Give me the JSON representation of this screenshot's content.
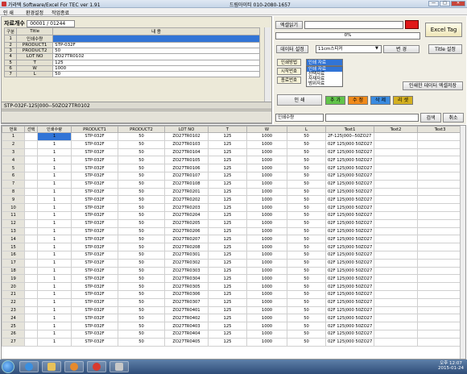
{
  "window": {
    "title": "가라텍 Software/Excel  For TEC    ver 1.91",
    "phone": "드림아이티 010-2080-1657"
  },
  "menu": [
    "인    쇄",
    "환경설정",
    "작업종료"
  ],
  "record": {
    "label": "자료개수",
    "value": "00001 / 01244"
  },
  "field_table": {
    "headers": [
      "구분",
      "Title",
      "내 용"
    ],
    "rows": [
      {
        "no": "1",
        "name": "인쇄수량",
        "value": "",
        "selected": true
      },
      {
        "no": "2",
        "name": "PRODUCT1",
        "value": "STP-032F",
        "selected": false
      },
      {
        "no": "3",
        "name": "PRODUCT2",
        "value": "50",
        "selected": false
      },
      {
        "no": "4",
        "name": "LOT NO",
        "value": "ZO27TR0102",
        "selected": false
      },
      {
        "no": "5",
        "name": "T",
        "value": "125",
        "selected": false
      },
      {
        "no": "6",
        "name": "W",
        "value": "1000",
        "selected": false
      },
      {
        "no": "7",
        "name": "L",
        "value": "50",
        "selected": false
      }
    ]
  },
  "barcode_text": "STP-032F-125|000--50ZO27TR0102",
  "right": {
    "excel_read": "엑셀읽기",
    "progress": "0%",
    "excel_tag": "Excel Tag",
    "data_setting": "데이터 설정",
    "label_select": "11cm스티커",
    "change": "변 경",
    "title_setting": "Title 설정",
    "print_method": "인쇄방법",
    "start_no": "시작번호",
    "end_no": "종료번호",
    "print_combo": "인쇄 자료",
    "dropdown_options": [
      "인쇄 자료",
      "선택자료",
      "자재자료",
      "범위자료"
    ],
    "save_printed": "인쇄한 데이터 엑셀저장",
    "print": "인      쇄",
    "add": "추 가",
    "edit": "수 정",
    "delete": "삭 제",
    "reset": "리 셋",
    "search_field": "인쇄수량",
    "search": "검색",
    "cancel": "취소"
  },
  "colors": {
    "add": "#62c44a",
    "edit": "#f08a1a",
    "delete": "#3a8be0",
    "reset": "#d4b020",
    "selection": "#3174d6"
  },
  "grid": {
    "headers": [
      "번호",
      "선택",
      "인쇄수량",
      "PRODUCT1",
      "PRODUCT2",
      "LOT NO",
      "T",
      "W",
      "L",
      "Text1",
      "Text2",
      "Text3"
    ],
    "rows": [
      [
        "1",
        "",
        "1",
        "STP-032F",
        "50",
        "ZO27TR0102",
        "125",
        "1000",
        "50",
        "2F-125|000--50ZO27",
        "",
        ""
      ],
      [
        "2",
        "",
        "1",
        "STP-032F",
        "50",
        "ZO27TR0103",
        "125",
        "1000",
        "50",
        "02F 125|000 50ZO27",
        "",
        ""
      ],
      [
        "3",
        "",
        "1",
        "STP-032F",
        "50",
        "ZO27TR0104",
        "125",
        "1000",
        "50",
        "02F 125|000 50ZO27",
        "",
        ""
      ],
      [
        "4",
        "",
        "1",
        "STP-032F",
        "50",
        "ZO27TR0105",
        "125",
        "1000",
        "50",
        "02F 125|000 50ZO27",
        "",
        ""
      ],
      [
        "5",
        "",
        "1",
        "STP-032F",
        "50",
        "ZO27TR0106",
        "125",
        "1000",
        "50",
        "02F 125|000 50ZO27",
        "",
        ""
      ],
      [
        "6",
        "",
        "1",
        "STP-032F",
        "50",
        "ZO27TR0107",
        "125",
        "1000",
        "50",
        "02F 125|000 50ZO27",
        "",
        ""
      ],
      [
        "7",
        "",
        "1",
        "STP-032F",
        "50",
        "ZO27TR0108",
        "125",
        "1000",
        "50",
        "02F 125|000 50ZO27",
        "",
        ""
      ],
      [
        "8",
        "",
        "1",
        "STP-032F",
        "50",
        "ZO27TR0201",
        "125",
        "1000",
        "50",
        "02F 125|000 50ZO27",
        "",
        ""
      ],
      [
        "9",
        "",
        "1",
        "STP-032F",
        "50",
        "ZO27TR0202",
        "125",
        "1000",
        "50",
        "02F 125|000 50ZO27",
        "",
        ""
      ],
      [
        "10",
        "",
        "1",
        "STP-032F",
        "50",
        "ZO27TR0203",
        "125",
        "1000",
        "50",
        "02F 125|000 50ZO27",
        "",
        ""
      ],
      [
        "11",
        "",
        "1",
        "STP-032F",
        "50",
        "ZO27TR0204",
        "125",
        "1000",
        "50",
        "02F 125|000 50ZO27",
        "",
        ""
      ],
      [
        "12",
        "",
        "1",
        "STP-032F",
        "50",
        "ZO27TR0205",
        "125",
        "1000",
        "50",
        "02F 125|000 50ZO27",
        "",
        ""
      ],
      [
        "13",
        "",
        "1",
        "STP-032F",
        "50",
        "ZO27TR0206",
        "125",
        "1000",
        "50",
        "02F 125|000 50ZO27",
        "",
        ""
      ],
      [
        "14",
        "",
        "1",
        "STP-032F",
        "50",
        "ZO27TR0207",
        "125",
        "1000",
        "50",
        "02F 125|000 50ZO27",
        "",
        ""
      ],
      [
        "15",
        "",
        "1",
        "STP-032F",
        "50",
        "ZO27TR0208",
        "125",
        "1000",
        "50",
        "02F 125|000 50ZO27",
        "",
        ""
      ],
      [
        "16",
        "",
        "1",
        "STP-032F",
        "50",
        "ZO27TR0301",
        "125",
        "1000",
        "50",
        "02F 125|000 50ZO27",
        "",
        ""
      ],
      [
        "17",
        "",
        "1",
        "STP-032F",
        "50",
        "ZO27TR0302",
        "125",
        "1000",
        "50",
        "02F 125|000 50ZO27",
        "",
        ""
      ],
      [
        "18",
        "",
        "1",
        "STP-032F",
        "50",
        "ZO27TR0303",
        "125",
        "1000",
        "50",
        "02F 125|000 50ZO27",
        "",
        ""
      ],
      [
        "19",
        "",
        "1",
        "STP-032F",
        "50",
        "ZO27TR0304",
        "125",
        "1000",
        "50",
        "02F 125|000 50ZO27",
        "",
        ""
      ],
      [
        "20",
        "",
        "1",
        "STP-032F",
        "50",
        "ZO27TR0305",
        "125",
        "1000",
        "50",
        "02F 125|000 50ZO27",
        "",
        ""
      ],
      [
        "21",
        "",
        "1",
        "STP-032F",
        "50",
        "ZO27TR0306",
        "125",
        "1000",
        "50",
        "02F 125|000 50ZO27",
        "",
        ""
      ],
      [
        "22",
        "",
        "1",
        "STP-032F",
        "50",
        "ZO27TR0307",
        "125",
        "1000",
        "50",
        "02F 125|000 50ZO27",
        "",
        ""
      ],
      [
        "23",
        "",
        "1",
        "STP-032F",
        "50",
        "ZO27TR0401",
        "125",
        "1000",
        "50",
        "02F 125|000 50ZO27",
        "",
        ""
      ],
      [
        "24",
        "",
        "1",
        "STP-032F",
        "50",
        "ZO27TR0402",
        "125",
        "1000",
        "50",
        "02F 125|000 50ZO27",
        "",
        ""
      ],
      [
        "25",
        "",
        "1",
        "STP-032F",
        "50",
        "ZO27TR0403",
        "125",
        "1000",
        "50",
        "02F 125|000 50ZO27",
        "",
        ""
      ],
      [
        "26",
        "",
        "1",
        "STP-032F",
        "50",
        "ZO27TR0404",
        "125",
        "1000",
        "50",
        "02F 125|000 50ZO27",
        "",
        ""
      ],
      [
        "27",
        "",
        "1",
        "STP-032F",
        "50",
        "ZO27TR0405",
        "125",
        "1000",
        "50",
        "02F 125|000 50ZO27",
        "",
        ""
      ]
    ]
  },
  "taskbar": {
    "time": "오후 12:07",
    "date": "2015-01-24"
  }
}
